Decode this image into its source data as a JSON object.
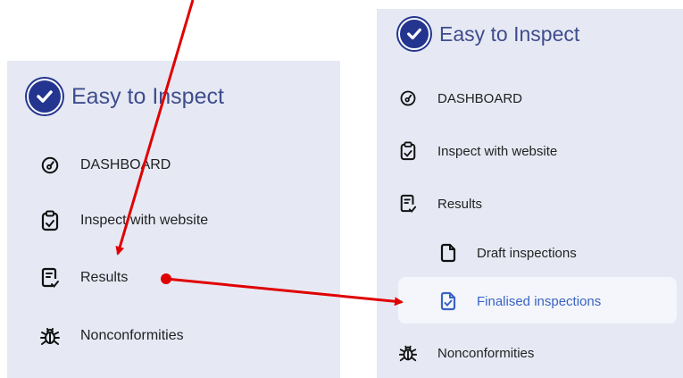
{
  "left_sidebar": {
    "title": "Easy to Inspect",
    "items": [
      {
        "label": "DASHBOARD",
        "icon": "gauge-icon"
      },
      {
        "label": "Inspect with website",
        "icon": "clipboard-check-icon"
      },
      {
        "label": "Results",
        "icon": "document-check-icon"
      },
      {
        "label": "Nonconformities",
        "icon": "bug-icon"
      }
    ]
  },
  "right_sidebar": {
    "title": "Easy to Inspect",
    "items": [
      {
        "label": "DASHBOARD",
        "icon": "gauge-icon"
      },
      {
        "label": "Inspect with website",
        "icon": "clipboard-check-icon"
      },
      {
        "label": "Results",
        "icon": "document-check-icon"
      },
      {
        "label": "Draft inspections",
        "icon": "file-icon"
      },
      {
        "label": "Finalised inspections",
        "icon": "file-check-icon",
        "active": true
      },
      {
        "label": "Nonconformities",
        "icon": "bug-icon"
      }
    ]
  },
  "colors": {
    "panel_bg": "#e6e9f4",
    "brand": "#23358f",
    "title_text": "#3f4d8c",
    "active_text": "#3a63c4",
    "annotation_arrow": "#e00000"
  }
}
